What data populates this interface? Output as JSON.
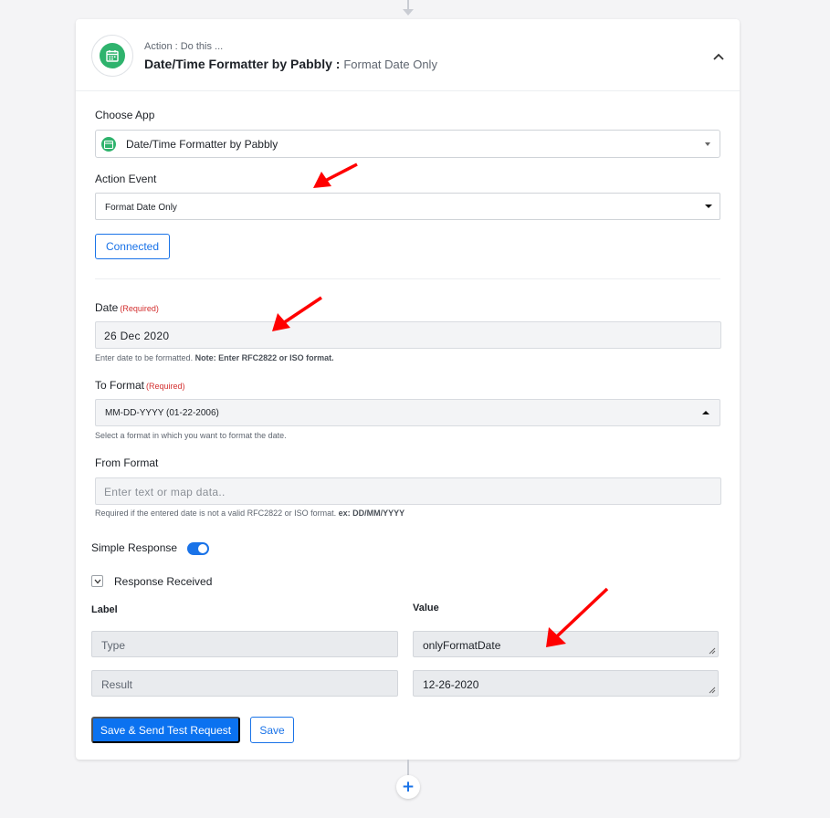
{
  "step_header": {
    "subtitle": "Action : Do this ...",
    "app_name": "Date/Time Formatter by Pabbly :",
    "event_name": "Format Date Only",
    "app_icon": "calendar-icon",
    "collapse_icon": "chevron-up-icon"
  },
  "choose_app": {
    "label": "Choose App",
    "value": "Date/Time Formatter by Pabbly"
  },
  "action_event": {
    "label": "Action Event",
    "value": "Format Date Only"
  },
  "connection": {
    "button_label": "Connected"
  },
  "fields": {
    "date": {
      "label": "Date",
      "required": "(Required)",
      "value": "26 Dec 2020",
      "help": "Enter date to be formatted.",
      "help_note": "Note: Enter RFC2822 or ISO format."
    },
    "to_format": {
      "label": "To Format",
      "required": "(Required)",
      "value": "MM-DD-YYYY (01-22-2006)",
      "help": "Select a format in which you want to format the date."
    },
    "from_format": {
      "label": "From Format",
      "placeholder": "Enter text or map data..",
      "help": "Required if the entered date is not a valid RFC2822 or ISO format.",
      "help_note": "ex: DD/MM/YYYY"
    }
  },
  "simple_response": {
    "label": "Simple Response",
    "enabled": true
  },
  "response": {
    "toggle_label": "Response Received",
    "label_header": "Label",
    "value_header": "Value",
    "rows": [
      {
        "label": "Type",
        "value": "onlyFormatDate"
      },
      {
        "label": "Result",
        "value": "12-26-2020"
      }
    ]
  },
  "actions": {
    "save_test_label": "Save & Send Test Request",
    "save_label": "Save",
    "add_step_label": "+"
  },
  "colors": {
    "accent": "#1a73e8",
    "primary_button": "#0b72f0",
    "app_logo": "#2fb36d",
    "required": "#d32f2f",
    "annotation_arrow": "#ff0000"
  }
}
